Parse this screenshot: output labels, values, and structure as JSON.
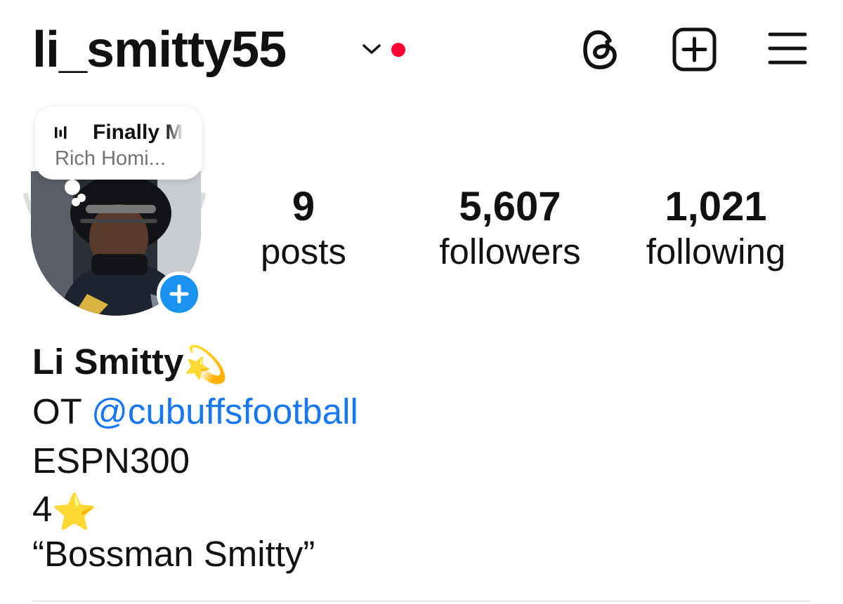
{
  "header": {
    "username": "li_smitty55",
    "dropdown_icon": "chevron-down-icon",
    "notification_color": "#ff0033",
    "actions": [
      {
        "icon": "threads-icon"
      },
      {
        "icon": "new-post-icon"
      },
      {
        "icon": "menu-icon"
      }
    ]
  },
  "note": {
    "song_title": "Finally M",
    "artist": "Rich Homi..."
  },
  "stats": {
    "posts_count": "9",
    "posts_label": "posts",
    "followers_count": "5,607",
    "followers_label": "followers",
    "following_count": "1,021",
    "following_label": "following"
  },
  "bio": {
    "name": "Li Smitty",
    "name_emoji": "💫",
    "position": "OT",
    "mention": "@cubuffsfootball",
    "line2": "ESPN300",
    "rating": "4",
    "rating_emoji": "⭐",
    "nickname": "“Bossman Smitty”"
  },
  "colors": {
    "accent_blue": "#1a94f0",
    "link_blue": "#1877f2",
    "text": "#111111",
    "muted": "#737373"
  }
}
